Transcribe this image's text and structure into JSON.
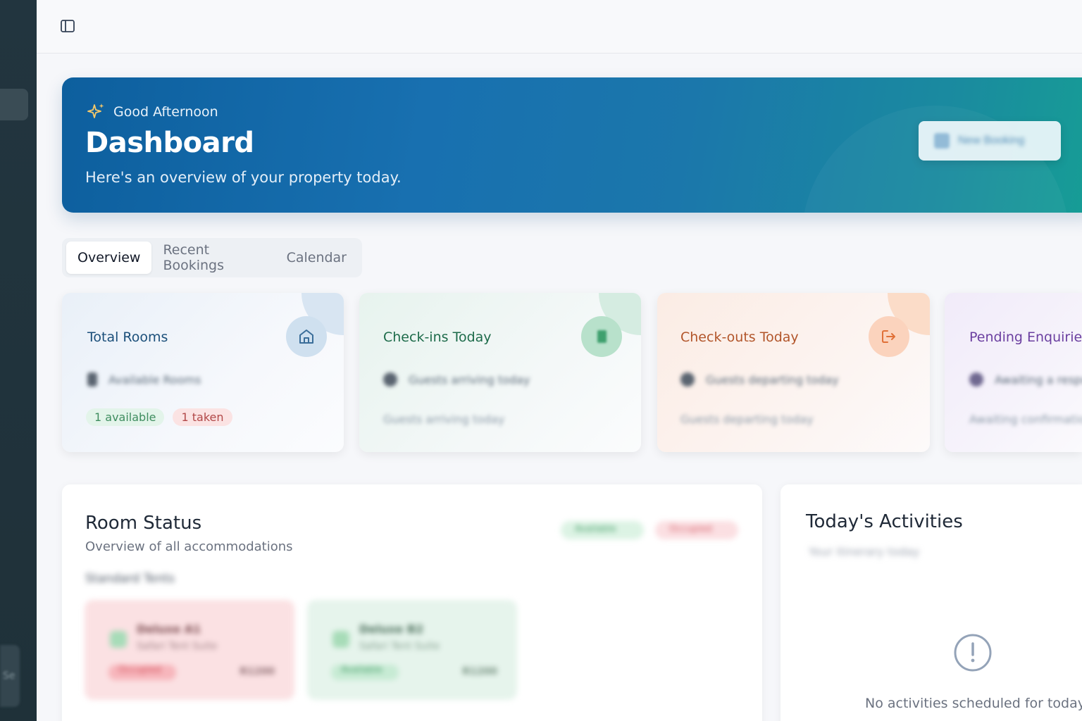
{
  "header": {
    "greeting": "Good Afternoon",
    "title": "Dashboard",
    "subtitle": "Here's an overview of your property today.",
    "action_label": "New Booking"
  },
  "tabs": [
    {
      "label": "Overview",
      "active": true
    },
    {
      "label": "Recent Bookings",
      "active": false
    },
    {
      "label": "Calendar",
      "active": false
    }
  ],
  "stats": {
    "total_rooms": {
      "title": "Total Rooms",
      "detail": "Available Rooms",
      "available": "1 available",
      "taken": "1 taken"
    },
    "checkins": {
      "title": "Check-ins Today",
      "detail": "Guests arriving today",
      "note": "Guests arriving today"
    },
    "checkouts": {
      "title": "Check-outs Today",
      "detail": "Guests departing today",
      "note": "Guests departing today"
    },
    "enquiries": {
      "title": "Pending Enquiries",
      "detail": "Awaiting a response",
      "note": "Awaiting confirmation"
    }
  },
  "room_status": {
    "title": "Room Status",
    "subtitle": "Overview of all accommodations",
    "section": "Standard Tents",
    "legend": [
      "Available",
      "Occupied"
    ],
    "rooms": [
      {
        "name": "Deluxe A1",
        "type": "Safari Tent Suite",
        "status": "Occupied",
        "rate": "R1200"
      },
      {
        "name": "Deluxe B2",
        "type": "Safari Tent Suite",
        "status": "Available",
        "rate": "R1200"
      }
    ]
  },
  "activities": {
    "title": "Today's Activities",
    "subtitle": "Your itinerary today",
    "empty": "No activities scheduled for today"
  },
  "rail": {
    "bottom_label": "Se"
  },
  "colors": {
    "hero_start": "#0d5f9e",
    "hero_end": "#169e95",
    "rooms_accent": "#1b4f7a",
    "checkin_accent": "#1d6b4a",
    "checkout_accent": "#b2552a",
    "enquiry_accent": "#6b3fa0"
  }
}
